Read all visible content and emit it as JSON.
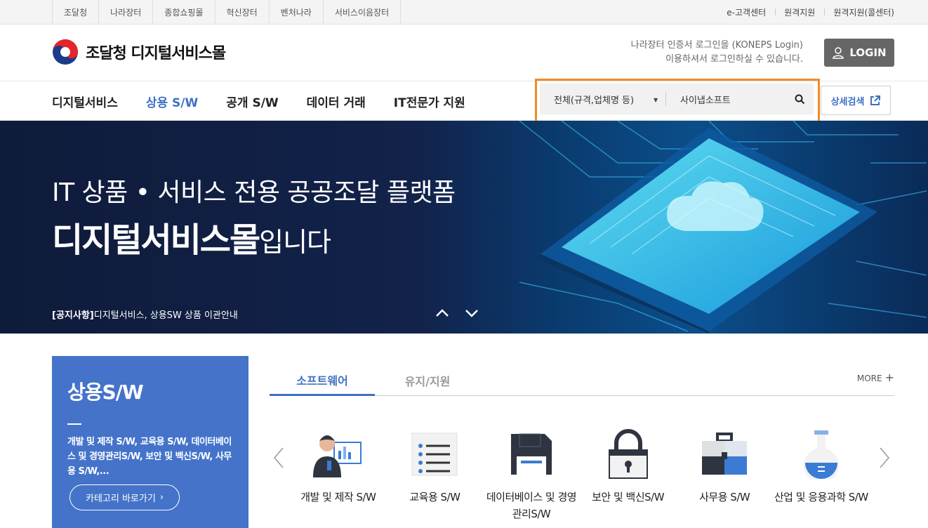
{
  "topbar": {
    "left_links": [
      "조달청",
      "나라장터",
      "종합쇼핑몰",
      "혁신장터",
      "벤처나라",
      "서비스이음장터"
    ],
    "right_links": [
      "e-고객센터",
      "원격지원",
      "원격지원(콜센터)"
    ]
  },
  "header": {
    "logo_text": "조달청 디지털서비스몰",
    "login_note_line1": "나라장터 인증서 로그인을 (KONEPS Login)",
    "login_note_line2": "이용하셔서 로그인하실 수 있습니다.",
    "login_label": "LOGIN"
  },
  "nav": {
    "items": [
      "디지털서비스",
      "상용 S/W",
      "공개 S/W",
      "데이터 거래",
      "IT전문가 지원"
    ],
    "active_index": 1
  },
  "search": {
    "scope_value": "전체(규격,업체명 등)",
    "query_value": "사이냅소프트",
    "detail_label": "상세검색"
  },
  "hero": {
    "line1": "IT 상품 • 서비스 전용 공공조달 플랫폼",
    "line2_bold": "디지털서비스몰",
    "line2_rest": "입니다",
    "notice_tag": "[공지사항]",
    "notice_text": "디지털서비스, 상용SW 상품 이관안내"
  },
  "left_card": {
    "title": "상용S/W",
    "desc": "개발 및 제작 S/W, 교육용 S/W, 데이터베이스 및 경영관리S/W, 보안 및 백신S/W, 사무용 S/W,...",
    "button_label": "카테고리 바로가기"
  },
  "tabs": {
    "items": [
      "소프트웨어",
      "유지/지원"
    ],
    "more_label": "MORE"
  },
  "products": [
    {
      "label": "개발 및 제작 S/W",
      "icon": "developer-icon"
    },
    {
      "label": "교육용 S/W",
      "icon": "notepad-icon"
    },
    {
      "label": "데이터베이스 및 경영관리S/W",
      "icon": "floppy-disk-icon"
    },
    {
      "label": "보안 및 백신S/W",
      "icon": "padlock-icon"
    },
    {
      "label": "사무용 S/W",
      "icon": "briefcase-icon"
    },
    {
      "label": "산업 및 응용과학 S/W",
      "icon": "flask-icon"
    }
  ],
  "colors": {
    "accent": "#3f70c5",
    "highlight_border": "#f08a24",
    "hero_bg": "#12224a",
    "card_bg": "#4473c9"
  }
}
